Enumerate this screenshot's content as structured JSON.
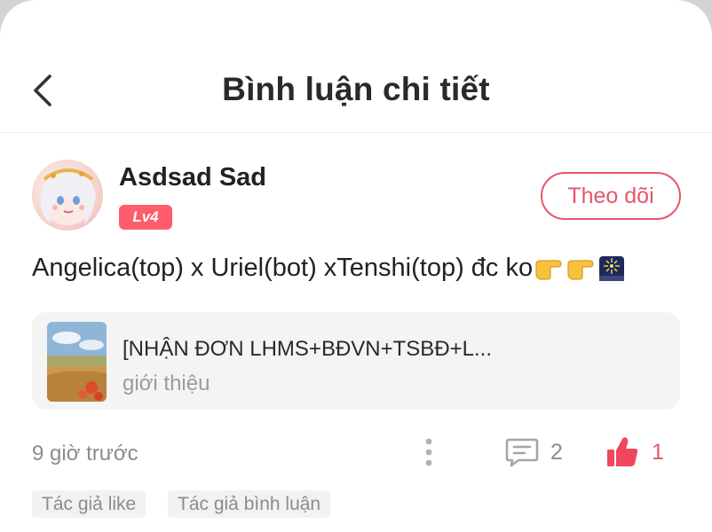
{
  "header": {
    "title": "Bình luận chi tiết",
    "back_icon": "chevron-left-icon"
  },
  "comment": {
    "author": "Asdsad Sad",
    "level": "Lv4",
    "follow_label": "Theo dõi",
    "text": "Angelica(top) x Uriel(bot) xTenshi(top) đc ko",
    "emojis": [
      "backhand-index-pointing-right-icon",
      "backhand-index-pointing-right-icon",
      "fireworks-icon"
    ],
    "time": "9 giờ trước",
    "reply_count": "2",
    "like_count": "1"
  },
  "post": {
    "title": "[NHẬN ĐƠN LHMS+BĐVN+TSBĐ+L...",
    "subtitle": "giới thiệu"
  },
  "tags": [
    "Tác giả like",
    "Tác giả bình luận"
  ],
  "colors": {
    "accent": "#e6566c",
    "badge": "#ff5c6c",
    "card_bg": "#f4f4f4",
    "muted": "#8c8c8c"
  }
}
